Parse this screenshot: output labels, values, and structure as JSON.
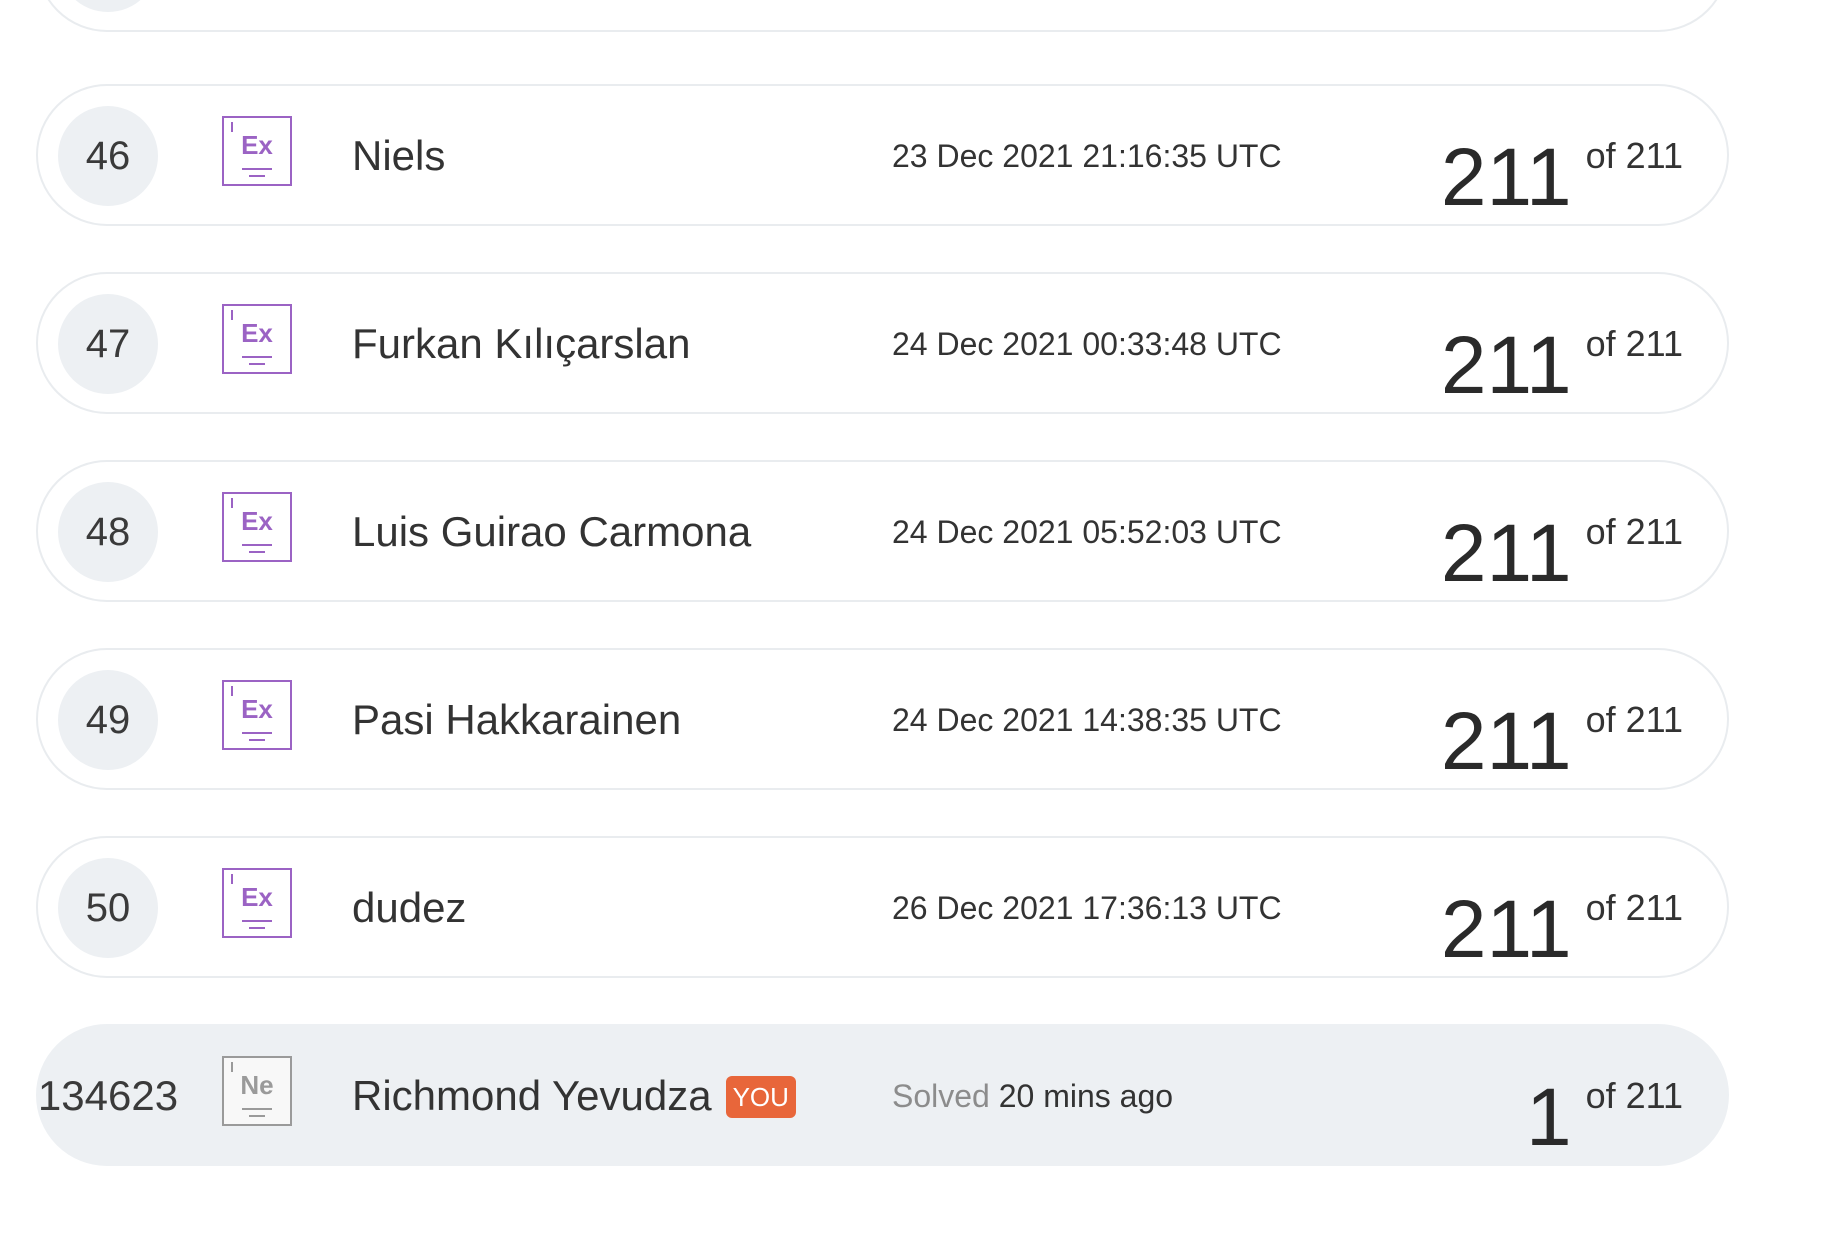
{
  "leaderboard": {
    "rows": [
      {
        "rank": "46",
        "badge": "Ex",
        "name": "Niels",
        "date": "23 Dec 2021 21:16:35 UTC",
        "solved": "211",
        "of_total": "of 211"
      },
      {
        "rank": "47",
        "badge": "Ex",
        "name": "Furkan Kılıçarslan",
        "date": "24 Dec 2021 00:33:48 UTC",
        "solved": "211",
        "of_total": "of 211"
      },
      {
        "rank": "48",
        "badge": "Ex",
        "name": "Luis Guirao Carmona",
        "date": "24 Dec 2021 05:52:03 UTC",
        "solved": "211",
        "of_total": "of 211"
      },
      {
        "rank": "49",
        "badge": "Ex",
        "name": "Pasi Hakkarainen",
        "date": "24 Dec 2021 14:38:35 UTC",
        "solved": "211",
        "of_total": "of 211"
      },
      {
        "rank": "50",
        "badge": "Ex",
        "name": "dudez",
        "date": "26 Dec 2021 17:36:13 UTC",
        "solved": "211",
        "of_total": "of 211"
      }
    ],
    "current_user": {
      "rank": "134623",
      "badge": "Ne",
      "name": "Richmond Yevudza",
      "you_label": "YOU",
      "solved_label": "Solved",
      "solved_time": "20 mins ago",
      "solved": "1",
      "of_total": "of 211"
    }
  },
  "colors": {
    "expert_badge": "#9b63c4",
    "newbie_badge": "#9a9a9a",
    "you_tag": "#e8663a",
    "current_row_bg": "#edf0f3",
    "rank_circle_bg": "#edf0f3",
    "row_border": "#e9ecef"
  },
  "icons": {
    "rank_badge_expert": "expert-rank-icon",
    "rank_badge_newbie": "newbie-rank-icon"
  }
}
